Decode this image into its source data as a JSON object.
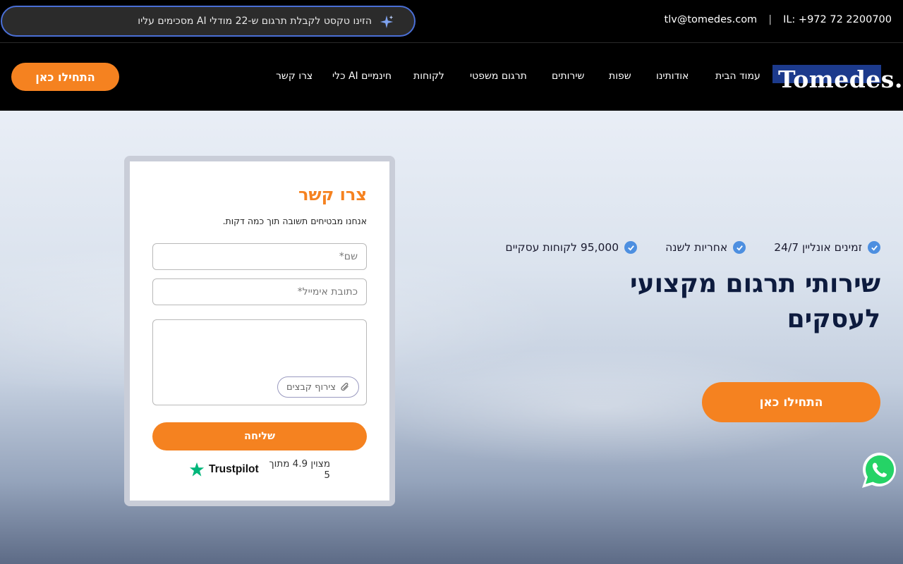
{
  "topbar": {
    "ai_banner": "הזינו טקסט לקבלת תרגום ש-22 מודלי AI מסכימים עליו",
    "phone": "IL: +972 72 2200700",
    "separator": "|",
    "email": "tlv@tomedes.com"
  },
  "nav": {
    "logo": "Tomedes.",
    "items": [
      "עמוד הבית",
      "אודותינו",
      "שפות",
      "שירותים",
      "תרגום משפטי",
      "לקוחות",
      "כלי AI חינמיים",
      "צרו קשר"
    ],
    "cta": "התחילו כאן"
  },
  "hero": {
    "features": [
      "זמינים אונליין 24/7",
      "אחריות לשנה",
      "95,000 לקוחות עסקיים"
    ],
    "title": "שירותי תרגום מקצועי לעסקים",
    "cta": "התחילו כאן"
  },
  "form": {
    "title": "צרו קשר",
    "subtitle": "אנחנו מבטיחים תשובה תוך כמה דקות.",
    "name_placeholder": "שם*",
    "email_placeholder": "כתובת אימייל*",
    "attach_label": "צירוף קבצים",
    "send_label": "שליחה",
    "rating_text": "מצוין 4.9 מתוך 5",
    "trustpilot": "Trustpilot"
  },
  "colors": {
    "accent": "#f58220",
    "navy": "#0d1b3e",
    "check": "#4d8fe0",
    "whatsapp": "#25d366"
  }
}
